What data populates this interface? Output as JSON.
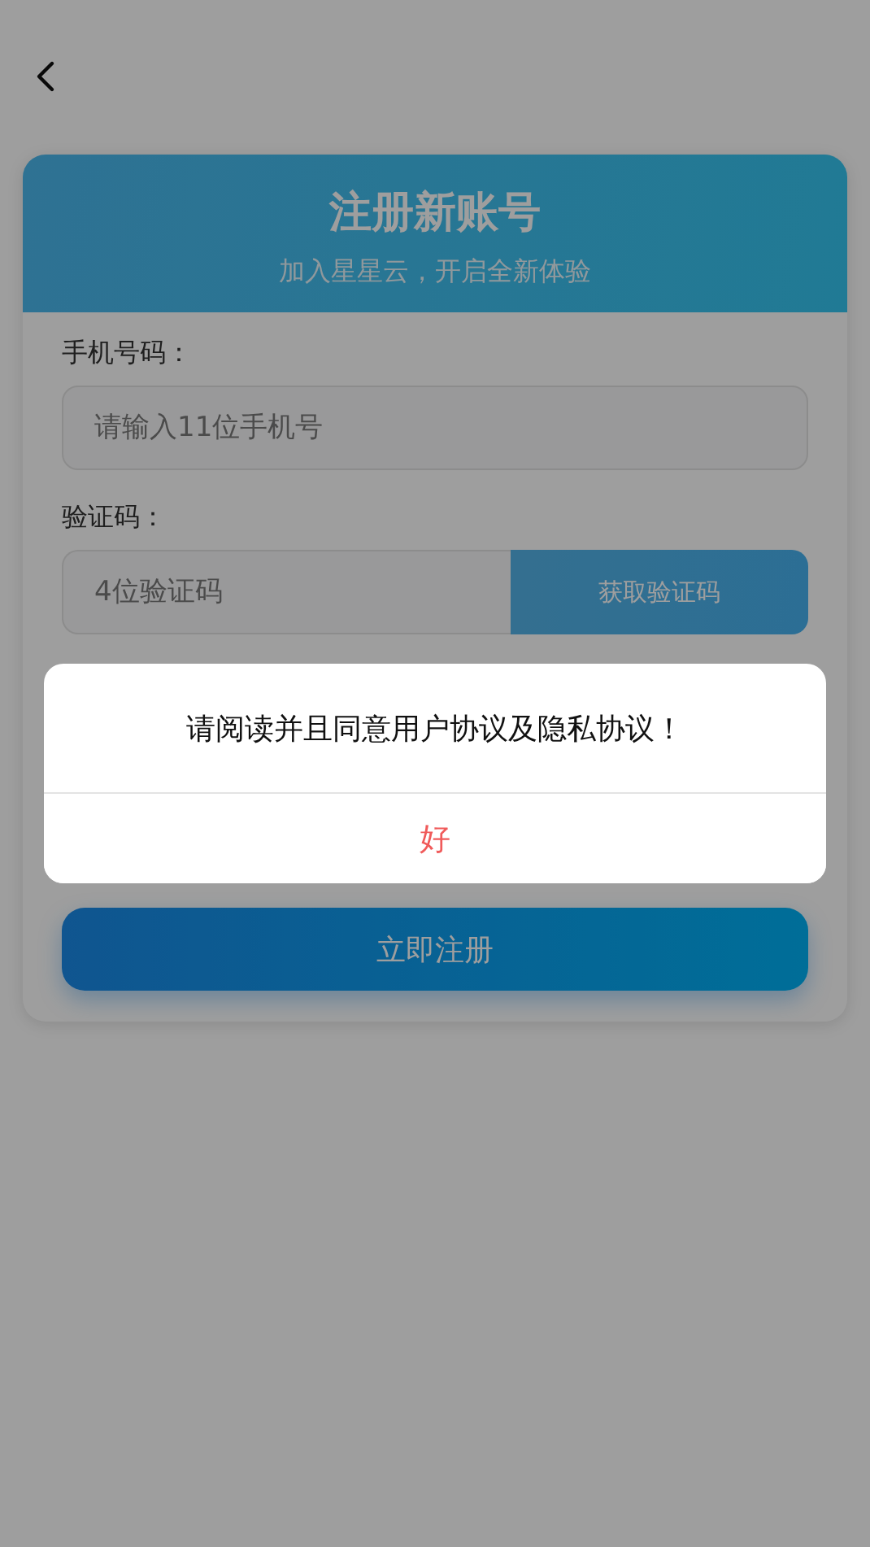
{
  "header": {
    "title": "注册新账号",
    "subtitle": "加入星星云，开启全新体验"
  },
  "fields": [
    {
      "kind": "input",
      "label": "手机号码：",
      "placeholder": "请输入11位手机号"
    },
    {
      "kind": "code",
      "label": "验证码：",
      "placeholder": "4位验证码",
      "button": "获取验证码"
    }
  ],
  "submit_button": "立即注册",
  "dialog": {
    "message": "请阅读并且同意用户协议及隐私协议！",
    "button": "好"
  }
}
